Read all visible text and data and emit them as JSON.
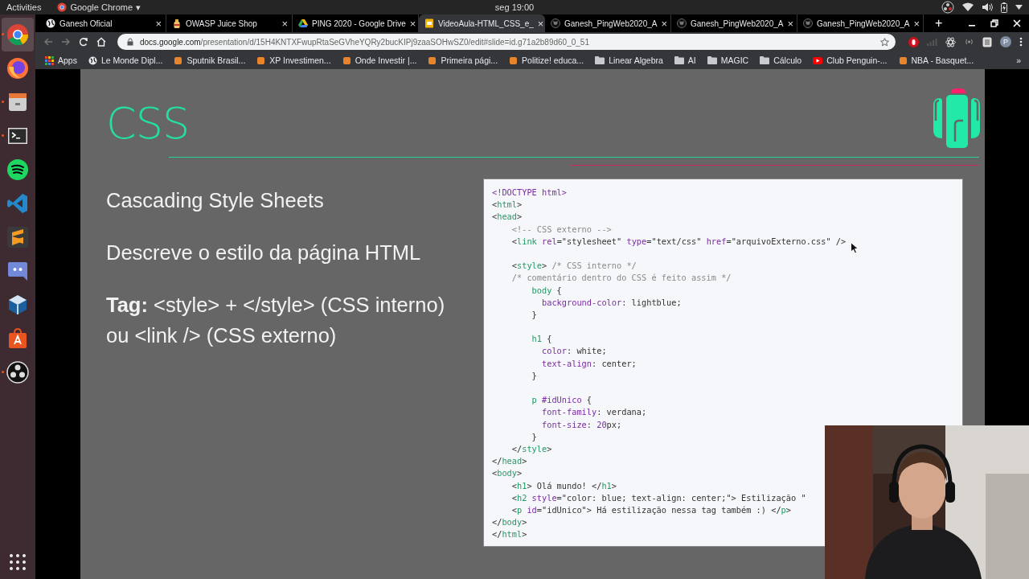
{
  "top_bar": {
    "activities": "Activities",
    "app_menu": "Google Chrome",
    "app_menu_caret": "▾",
    "clock": "seg 19:00"
  },
  "dock": [
    {
      "kind": "chrome",
      "running": true,
      "selected": true
    },
    {
      "kind": "firefox",
      "running": false,
      "selected": false
    },
    {
      "kind": "files",
      "running": true,
      "selected": false
    },
    {
      "kind": "terminal",
      "running": true,
      "selected": false
    },
    {
      "kind": "spotify",
      "running": false,
      "selected": false
    },
    {
      "kind": "vscode",
      "running": false,
      "selected": false
    },
    {
      "kind": "sublime",
      "running": false,
      "selected": false
    },
    {
      "kind": "discord",
      "running": false,
      "selected": false
    },
    {
      "kind": "virtualbox",
      "running": false,
      "selected": false
    },
    {
      "kind": "store",
      "running": false,
      "selected": false
    },
    {
      "kind": "obs",
      "running": true,
      "selected": false
    }
  ],
  "tabs": [
    {
      "title": "Ganesh Oficial",
      "kind": "globe",
      "selected": false
    },
    {
      "title": "OWASP Juice Shop",
      "kind": "bottle",
      "selected": false
    },
    {
      "title": "PING 2020 - Google Drive",
      "kind": "drive",
      "selected": false
    },
    {
      "title": "VideoAula-HTML_CSS_e_",
      "kind": "slides",
      "selected": true
    },
    {
      "title": "Ganesh_PingWeb2020_A",
      "kind": "github",
      "selected": false
    },
    {
      "title": "Ganesh_PingWeb2020_A",
      "kind": "github",
      "selected": false
    },
    {
      "title": "Ganesh_PingWeb2020_A",
      "kind": "github",
      "selected": false
    }
  ],
  "tab_close": "×",
  "new_tab": "+",
  "address": {
    "host": "docs.google.com",
    "path": "/presentation/d/15H4KNTXFwupRtaSeGVheYQRy2bucKIPj9zaaSOHwSZ0/edit#slide=id.g71a2b89d60_0_51"
  },
  "avatar": "P",
  "bookmarks": [
    {
      "label": "Apps",
      "kind": "apps"
    },
    {
      "label": "Le Monde Dipl...",
      "kind": "globe"
    },
    {
      "label": "Sputnik Brasil...",
      "kind": "site"
    },
    {
      "label": "XP Investimen...",
      "kind": "site"
    },
    {
      "label": "Onde Investir |...",
      "kind": "site"
    },
    {
      "label": "Primeira pági...",
      "kind": "site"
    },
    {
      "label": "Politize! educa...",
      "kind": "site"
    },
    {
      "label": "Linear Algebra",
      "kind": "folder"
    },
    {
      "label": "AI",
      "kind": "folder"
    },
    {
      "label": "MAGIC",
      "kind": "folder"
    },
    {
      "label": "Cálculo",
      "kind": "folder"
    },
    {
      "label": "Club Penguin-...",
      "kind": "video"
    },
    {
      "label": "NBA - Basquet...",
      "kind": "site"
    }
  ],
  "bookmarks_more": "»",
  "slide": {
    "title": "CSS",
    "points": [
      "Cascading Style Sheets",
      "Descreve o estilo da página HTML",
      "**Tag:** <style> + </style> (CSS interno) ou <link /> (CSS externo)"
    ],
    "code": [
      {
        "kind": "code",
        "segments": [
          {
            "kind": "attr",
            "text": "<!DOCTYPE html>"
          }
        ]
      },
      {
        "kind": "code",
        "segments": [
          {
            "kind": "punct",
            "text": "<"
          },
          {
            "kind": "tag",
            "text": "html"
          },
          {
            "kind": "punct",
            "text": ">"
          }
        ]
      },
      {
        "kind": "code",
        "segments": [
          {
            "kind": "punct",
            "text": "<"
          },
          {
            "kind": "tag",
            "text": "head"
          },
          {
            "kind": "punct",
            "text": ">"
          }
        ]
      },
      {
        "kind": "code",
        "segments": [
          {
            "kind": "comment",
            "text": "    <!-- CSS externo -->"
          }
        ]
      },
      {
        "kind": "code",
        "segments": [
          {
            "kind": "punct",
            "text": "    <"
          },
          {
            "kind": "tag",
            "text": "link"
          },
          {
            "kind": "attr",
            "text": " rel"
          },
          {
            "kind": "punct",
            "text": "="
          },
          {
            "kind": "str",
            "text": "\"stylesheet\""
          },
          {
            "kind": "attr",
            "text": " type"
          },
          {
            "kind": "punct",
            "text": "="
          },
          {
            "kind": "str",
            "text": "\"text/css\""
          },
          {
            "kind": "attr",
            "text": " href"
          },
          {
            "kind": "punct",
            "text": "="
          },
          {
            "kind": "str",
            "text": "\"arquivoExterno.css\""
          },
          {
            "kind": "punct",
            "text": " />"
          }
        ]
      },
      {
        "kind": "blank"
      },
      {
        "kind": "code",
        "segments": [
          {
            "kind": "punct",
            "text": "    <"
          },
          {
            "kind": "tag",
            "text": "style"
          },
          {
            "kind": "punct",
            "text": ">"
          },
          {
            "kind": "comment",
            "text": " /* CSS interno */"
          }
        ]
      },
      {
        "kind": "code",
        "segments": [
          {
            "kind": "comment",
            "text": "    /* comentário dentro do CSS é feito assim */"
          }
        ]
      },
      {
        "kind": "code",
        "segments": [
          {
            "kind": "tag",
            "text": "        body"
          },
          {
            "kind": "punct",
            "text": " {"
          }
        ]
      },
      {
        "kind": "code",
        "segments": [
          {
            "kind": "attr",
            "text": "          background-color"
          },
          {
            "kind": "punct",
            "text": ": lightblue;"
          }
        ]
      },
      {
        "kind": "code",
        "segments": [
          {
            "kind": "punct",
            "text": "        }"
          }
        ]
      },
      {
        "kind": "blank"
      },
      {
        "kind": "code",
        "segments": [
          {
            "kind": "tag",
            "text": "        h1"
          },
          {
            "kind": "punct",
            "text": " {"
          }
        ]
      },
      {
        "kind": "code",
        "segments": [
          {
            "kind": "attr",
            "text": "          color"
          },
          {
            "kind": "punct",
            "text": ": white;"
          }
        ]
      },
      {
        "kind": "code",
        "segments": [
          {
            "kind": "attr",
            "text": "          text-align"
          },
          {
            "kind": "punct",
            "text": ": center;"
          }
        ]
      },
      {
        "kind": "code",
        "segments": [
          {
            "kind": "punct",
            "text": "        }"
          }
        ]
      },
      {
        "kind": "blank"
      },
      {
        "kind": "code",
        "segments": [
          {
            "kind": "tag",
            "text": "        p"
          },
          {
            "kind": "attr",
            "text": " #idUnico"
          },
          {
            "kind": "punct",
            "text": " {"
          }
        ]
      },
      {
        "kind": "code",
        "segments": [
          {
            "kind": "attr",
            "text": "          font-family"
          },
          {
            "kind": "punct",
            "text": ": verdana;"
          }
        ]
      },
      {
        "kind": "code",
        "segments": [
          {
            "kind": "attr",
            "text": "          font-size"
          },
          {
            "kind": "punct",
            "text": ": "
          },
          {
            "kind": "num",
            "text": "20"
          },
          {
            "kind": "punct",
            "text": "px;"
          }
        ]
      },
      {
        "kind": "code",
        "segments": [
          {
            "kind": "punct",
            "text": "        }"
          }
        ]
      },
      {
        "kind": "code",
        "segments": [
          {
            "kind": "punct",
            "text": "    </"
          },
          {
            "kind": "tag",
            "text": "style"
          },
          {
            "kind": "punct",
            "text": ">"
          }
        ]
      },
      {
        "kind": "code",
        "segments": [
          {
            "kind": "punct",
            "text": "</"
          },
          {
            "kind": "tag",
            "text": "head"
          },
          {
            "kind": "punct",
            "text": ">"
          }
        ]
      },
      {
        "kind": "code",
        "segments": [
          {
            "kind": "punct",
            "text": "<"
          },
          {
            "kind": "tag",
            "text": "body"
          },
          {
            "kind": "punct",
            "text": ">"
          }
        ]
      },
      {
        "kind": "code",
        "segments": [
          {
            "kind": "punct",
            "text": "    <"
          },
          {
            "kind": "tag",
            "text": "h1"
          },
          {
            "kind": "punct",
            "text": "> Olá mundo! </"
          },
          {
            "kind": "tag",
            "text": "h1"
          },
          {
            "kind": "punct",
            "text": ">"
          }
        ]
      },
      {
        "kind": "code",
        "segments": [
          {
            "kind": "punct",
            "text": "    <"
          },
          {
            "kind": "tag",
            "text": "h2"
          },
          {
            "kind": "attr",
            "text": " style"
          },
          {
            "kind": "punct",
            "text": "="
          },
          {
            "kind": "str",
            "text": "\"color: blue; text-align: center;\""
          },
          {
            "kind": "punct",
            "text": "> Estilização \""
          }
        ]
      },
      {
        "kind": "code",
        "segments": [
          {
            "kind": "punct",
            "text": "    <"
          },
          {
            "kind": "tag",
            "text": "p"
          },
          {
            "kind": "attr",
            "text": " id"
          },
          {
            "kind": "punct",
            "text": "="
          },
          {
            "kind": "str",
            "text": "\"idUnico\""
          },
          {
            "kind": "punct",
            "text": "> Há estilização nessa tag também :) </"
          },
          {
            "kind": "tag",
            "text": "p"
          },
          {
            "kind": "punct",
            "text": ">"
          }
        ]
      },
      {
        "kind": "code",
        "segments": [
          {
            "kind": "punct",
            "text": "</"
          },
          {
            "kind": "tag",
            "text": "body"
          },
          {
            "kind": "punct",
            "text": ">"
          }
        ]
      },
      {
        "kind": "code",
        "segments": [
          {
            "kind": "punct",
            "text": "</"
          },
          {
            "kind": "tag",
            "text": "html"
          },
          {
            "kind": "punct",
            "text": ">"
          }
        ]
      }
    ]
  }
}
